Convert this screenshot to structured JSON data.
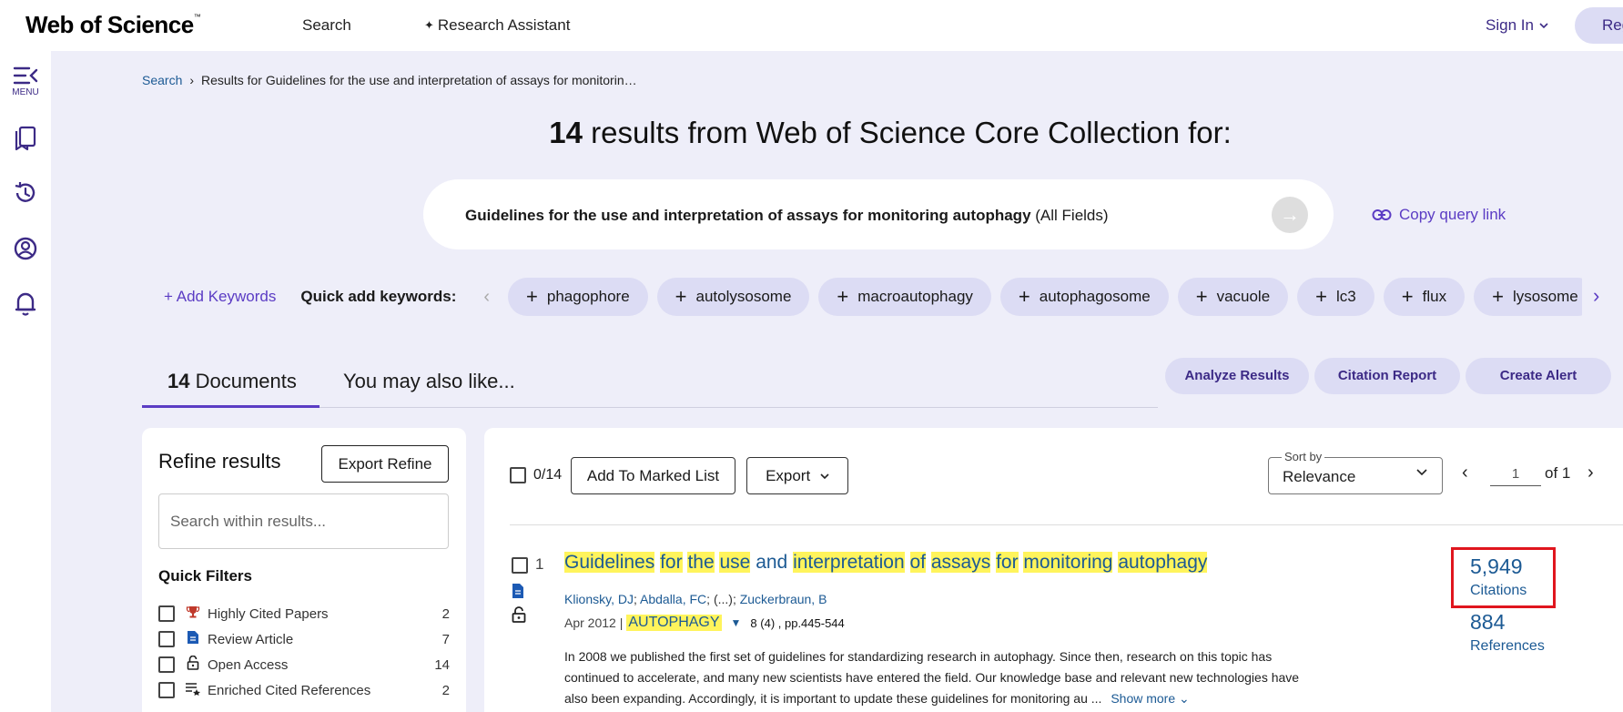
{
  "header": {
    "logo": "Web of Science",
    "logo_tm": "™",
    "nav_search": "Search",
    "nav_research_assistant": "Research Assistant",
    "sign_in": "Sign In",
    "register": "Reg"
  },
  "rail": {
    "menu_label": "MENU"
  },
  "breadcrumb": {
    "root": "Search",
    "current": "Results for Guidelines for the use and interpretation of assays for monitorin…"
  },
  "results_heading": {
    "count": "14",
    "text": "results from Web of Science Core Collection for:"
  },
  "query": {
    "text": "Guidelines for the use and interpretation of assays for monitoring autophagy",
    "field": "(All Fields)",
    "copy_link": "Copy query link"
  },
  "keywords": {
    "add_label": "Add Keywords",
    "quick_label": "Quick add keywords:",
    "chips": [
      "phagophore",
      "autolysosome",
      "macroautophagy",
      "autophagosome",
      "vacuole",
      "lc3",
      "flux",
      "lysosome"
    ]
  },
  "tabs": {
    "docs_count": "14",
    "docs_label": "Documents",
    "like_label": "You may also like..."
  },
  "actions": {
    "analyze": "Analyze Results",
    "citation_report": "Citation Report",
    "create_alert": "Create Alert"
  },
  "refine": {
    "title": "Refine results",
    "export_refine": "Export Refine",
    "search_placeholder": "Search within results...",
    "quick_filters_title": "Quick Filters",
    "filters": [
      {
        "label": "Highly Cited Papers",
        "count": "2",
        "icon": "trophy-icon"
      },
      {
        "label": "Review Article",
        "count": "7",
        "icon": "document-icon"
      },
      {
        "label": "Open Access",
        "count": "14",
        "icon": "unlock-icon"
      },
      {
        "label": "Enriched Cited References",
        "count": "2",
        "icon": "enriched-list-icon"
      }
    ]
  },
  "toolbar": {
    "selected": "0/14",
    "add_marked": "Add To Marked List",
    "export": "Export",
    "sort_legend": "Sort by",
    "sort_value": "Relevance",
    "page_value": "1",
    "page_of": "of 1"
  },
  "record": {
    "number": "1",
    "title_words": [
      "Guidelines",
      "for",
      "the",
      "use",
      "and",
      "interpretation",
      "of",
      "assays",
      "for",
      "monitoring",
      "autophagy"
    ],
    "author_1": "Klionsky, DJ",
    "author_2": "Abdalla, FC",
    "author_ellipsis": "(...)",
    "author_last": "Zuckerbraun, B",
    "date": "Apr 2012 |",
    "journal": "AUTOPHAGY",
    "volume": "8 (4) , pp.445-544",
    "abstract": "In 2008 we published the first set of guidelines for standardizing research in autophagy. Since then, research on this topic has continued to accelerate, and many new scientists have entered the field. Our knowledge base and relevant new technologies have also been expanding. Accordingly, it is important to update these guidelines for monitoring au ...",
    "show_more": "Show more",
    "citations_count": "5,949",
    "citations_label": "Citations",
    "references_count": "884",
    "references_label": "References"
  },
  "colors": {
    "accent": "#5b3cc4",
    "link": "#1c5a94",
    "highlight": "#fff45c",
    "annotation_box": "#e0161e",
    "page_bg": "#eeeef9"
  }
}
